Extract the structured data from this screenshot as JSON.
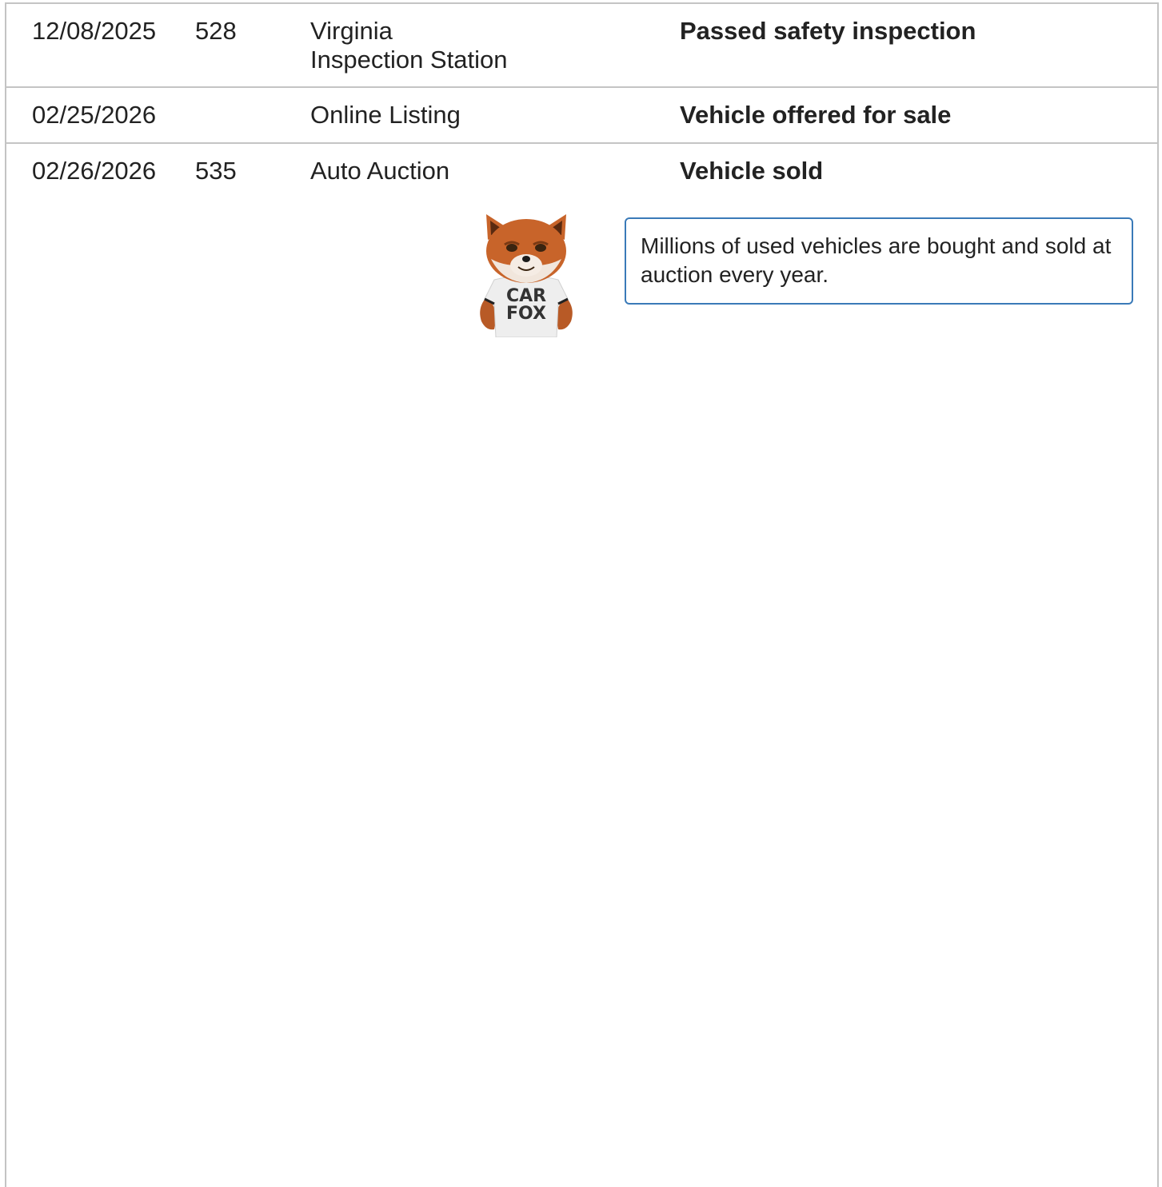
{
  "history": {
    "rows": [
      {
        "date": "12/08/2025",
        "odometer": "528",
        "source_lines": [
          "Virginia",
          "Inspection Station"
        ],
        "comment": "Passed safety inspection"
      },
      {
        "date": "02/25/2026",
        "odometer": "",
        "source_lines": [
          "Online Listing"
        ],
        "comment": "Vehicle offered for sale"
      },
      {
        "date": "02/26/2026",
        "odometer": "535",
        "source_lines": [
          "Auto Auction"
        ],
        "comment": "Vehicle sold"
      }
    ]
  },
  "mascot": {
    "icon": "carfox-mascot-icon",
    "shirt_text_line1": "CAR",
    "shirt_text_line2": "FOX"
  },
  "callout": {
    "text": "Millions of used vehicles are bought and sold at auction every year."
  },
  "colors": {
    "border": "#c4c4c4",
    "callout_border": "#3a7ab8",
    "text": "#222222",
    "fox_orange": "#c8642a"
  }
}
